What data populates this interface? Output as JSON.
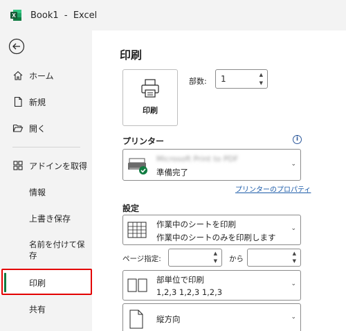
{
  "titlebar": {
    "title": "Book1  -  Excel",
    "logo_letter": "X"
  },
  "sidebar": {
    "items": [
      {
        "label": "ホーム"
      },
      {
        "label": "新規"
      },
      {
        "label": "開く"
      },
      {
        "label": "アドインを取得"
      },
      {
        "label": "情報"
      },
      {
        "label": "上書き保存"
      },
      {
        "label": "名前を付けて保"
      },
      {
        "label": "存"
      },
      {
        "label": "印刷"
      },
      {
        "label": "共有"
      }
    ]
  },
  "main": {
    "title": "印刷",
    "print_button_label": "印刷",
    "copies_label": "部数:",
    "copies_value": "1",
    "printer_heading": "プリンター",
    "printer_name": "Microsoft Print to PDF",
    "printer_status": "準備完了",
    "printer_properties_link": "プリンターのプロパティ",
    "settings_heading": "設定",
    "scope_line1": "作業中のシートを印刷",
    "scope_line2": "作業中のシートのみを印刷します",
    "pages_label": "ページ指定:",
    "pages_to": "から",
    "collate_line1": "部単位で印刷",
    "collate_line2": "1,2,3    1,2,3    1,2,3",
    "orientation": "縦方向"
  },
  "colors": {
    "accent": "#107c41",
    "highlight_box": "#e30000",
    "link": "#1a5aa8"
  }
}
